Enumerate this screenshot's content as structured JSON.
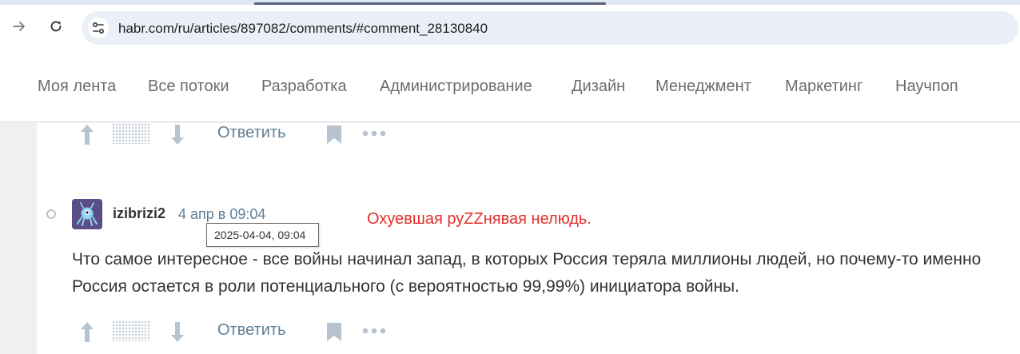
{
  "browser": {
    "url": "habr.com/ru/articles/897082/comments/#comment_28130840",
    "forward_icon": "arrow-right-icon",
    "reload_icon": "reload-icon",
    "site_info_icon": "tune-icon"
  },
  "nav": {
    "items": [
      {
        "label": "Моя лента"
      },
      {
        "label": "Все потоки"
      },
      {
        "label": "Разработка"
      },
      {
        "label": "Администрирование"
      },
      {
        "label": "Дизайн"
      },
      {
        "label": "Менеджмент"
      },
      {
        "label": "Маркетинг"
      },
      {
        "label": "Научпоп"
      }
    ]
  },
  "previous_comment": {
    "reply_label": "Ответить"
  },
  "comment": {
    "author": "izibrizi2",
    "time": "4 апр в 09:04",
    "tooltip": "2025-04-04, 09:04",
    "text": "Что самое интересное - все войны начинал запад, в которых Россия теряла миллионы людей, но почему-то именно Россия остается в роли потенциального (с вероятностью 99,99%) инициатора войны.",
    "reply_label": "Ответить"
  },
  "annotation": {
    "text": "Охуевшая руZZнявая нелюдь.",
    "color": "#e2302b"
  },
  "colors": {
    "link": "#5e7f98",
    "icon": "#b7c3cf",
    "nav_text": "#6b6e70"
  }
}
